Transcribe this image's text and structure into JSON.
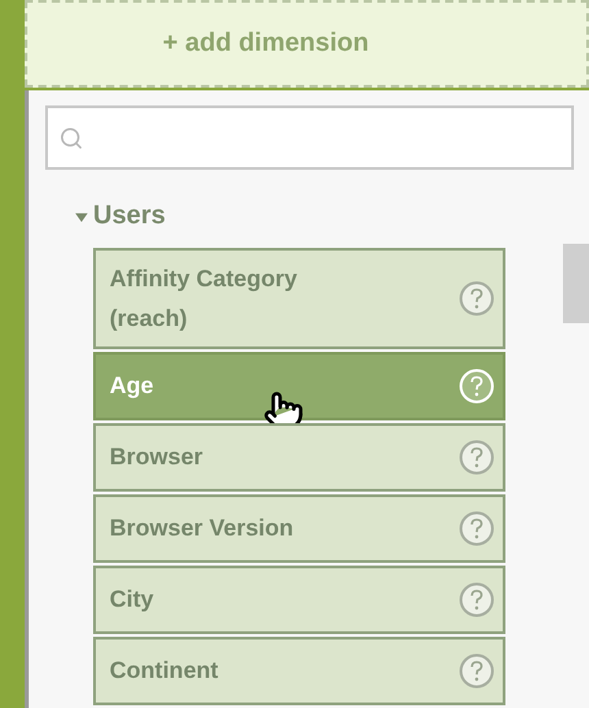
{
  "add_button": {
    "label": "+ add dimension"
  },
  "group": {
    "label": "Users",
    "expanded": true,
    "items": [
      {
        "label": "Affinity Category (reach)",
        "selected": false
      },
      {
        "label": "Age",
        "selected": true
      },
      {
        "label": "Browser",
        "selected": false
      },
      {
        "label": "Browser Version",
        "selected": false
      },
      {
        "label": "City",
        "selected": false
      },
      {
        "label": "Continent",
        "selected": false
      }
    ]
  }
}
